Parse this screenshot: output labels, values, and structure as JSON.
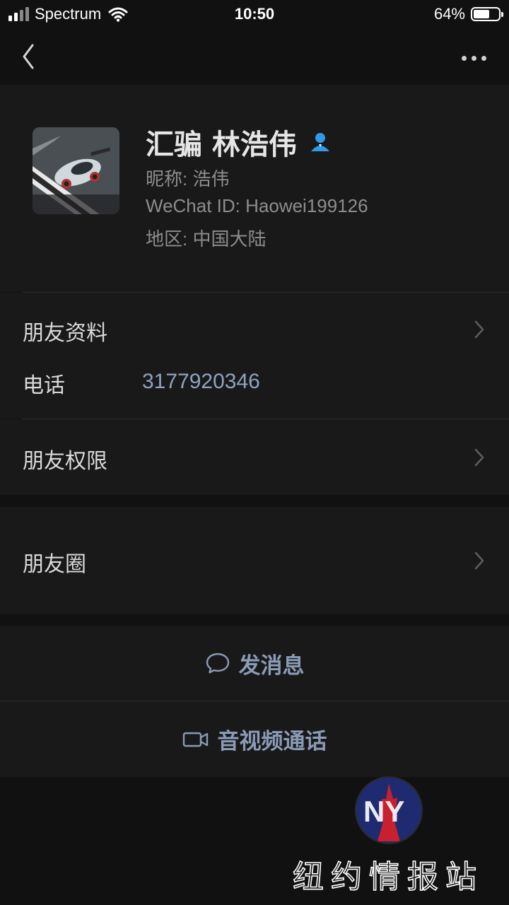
{
  "status_bar": {
    "carrier": "Spectrum",
    "time": "10:50",
    "battery_percent": "64%",
    "battery_level": 0.64
  },
  "nav": {
    "back_icon": "chevron-left-icon",
    "more_icon": "more-dots-icon"
  },
  "profile": {
    "name": "汇骗 林浩伟",
    "nickname": "昵称: 浩伟",
    "wechat_id": "WeChat ID: Haowei199126",
    "region": "地区: 中国大陆",
    "verified_icon": "person-badge-icon"
  },
  "rows": {
    "friend_profile": "朋友资料",
    "phone_label": "电话",
    "phone_value": "3177920346",
    "friend_permissions": "朋友权限",
    "moments": "朋友圈"
  },
  "actions": {
    "message": "发消息",
    "call": "音视频通话"
  },
  "watermark": {
    "text": "纽约情报站",
    "logo_letters": "NY"
  },
  "colors": {
    "background": "#111111",
    "panel": "#191919",
    "link_blue": "#8fa3bf",
    "action_blue": "#8a9bb6",
    "verified_blue": "#2f9be8"
  }
}
